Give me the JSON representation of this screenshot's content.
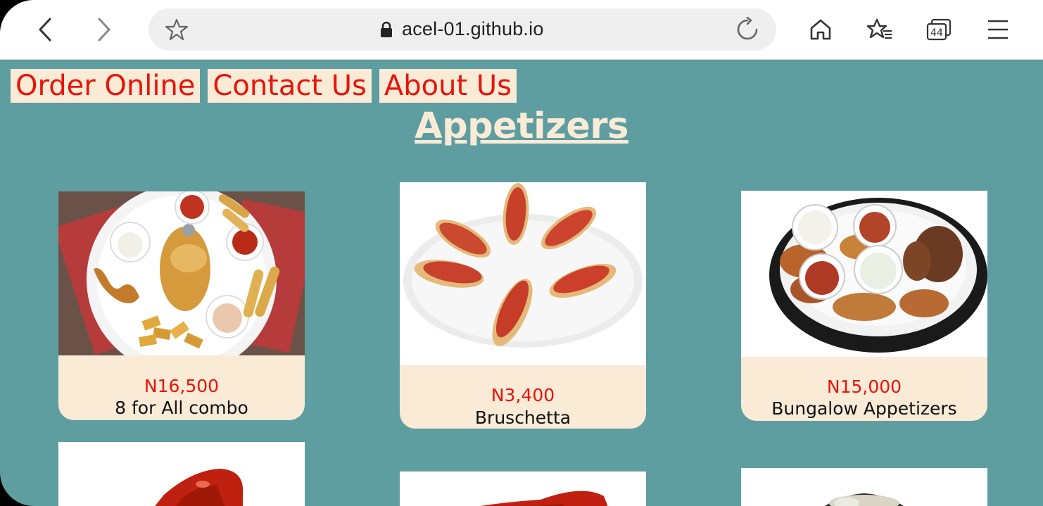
{
  "browser": {
    "url": "acel-01.github.io",
    "tab_count": "44"
  },
  "nav": {
    "links": [
      "Order Online",
      "Contact Us",
      "About Us"
    ]
  },
  "section": {
    "title": "Appetizers"
  },
  "menu_items": [
    {
      "price": "N16,500",
      "name": "8 for All combo"
    },
    {
      "price": "N3,400",
      "name": "Bruschetta"
    },
    {
      "price": "N15,000",
      "name": "Bungalow Appetizers"
    }
  ],
  "colors": {
    "page_bg": "#5f9ea0",
    "nav_bg": "#faebd7",
    "nav_text": "#e8140a",
    "price_text": "#e8140a"
  }
}
